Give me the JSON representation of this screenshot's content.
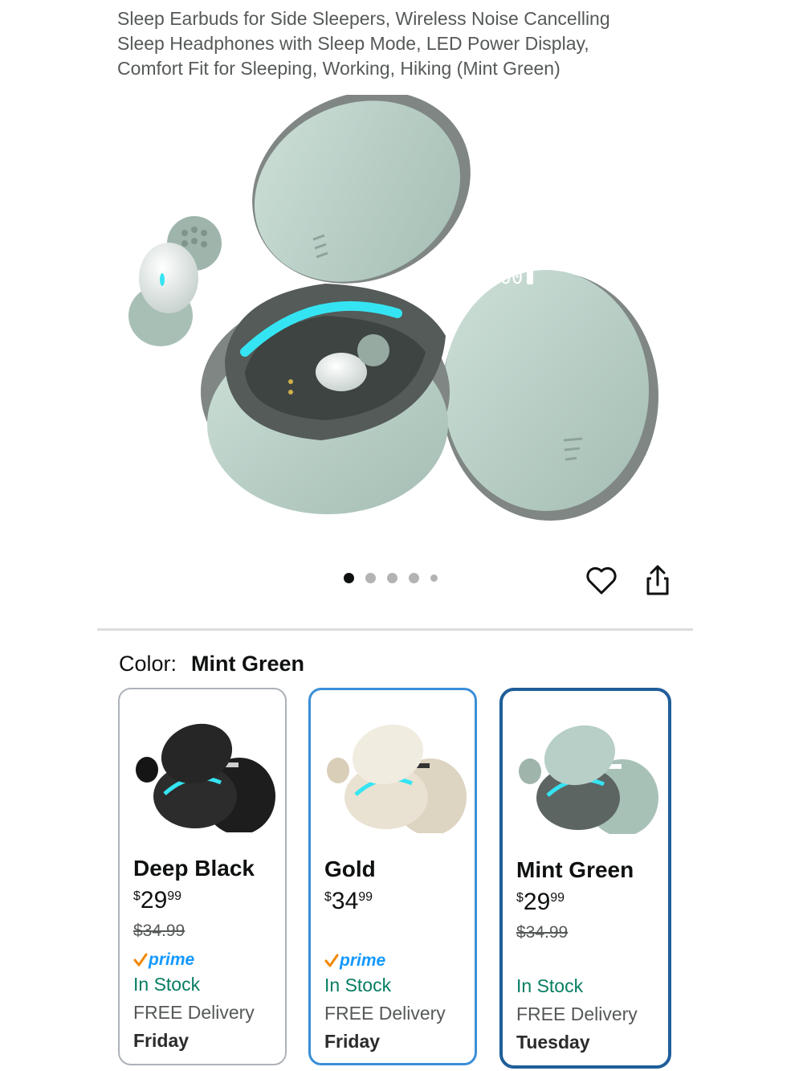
{
  "product": {
    "title_lines": [
      "Sleep Earbuds for Side Sleepers, Wireless Noise Cancelling",
      "Sleep Headphones with Sleep Mode, LED Power Display,",
      "Comfort Fit for Sleeping, Working, Hiking (Mint Green)"
    ],
    "case_display": "100"
  },
  "gallery": {
    "image_count": 5,
    "active_index": 0
  },
  "actions": {
    "wishlist_icon": "heart-icon",
    "share_icon": "share-icon"
  },
  "color_selector": {
    "label": "Color:",
    "selected": "Mint Green",
    "options": [
      {
        "name": "Deep Black",
        "currency": "$",
        "price_whole": "29",
        "price_fraction": "99",
        "list_price": "$34.99",
        "prime": "prime",
        "stock": "In Stock",
        "delivery": "FREE Delivery",
        "day": "Friday",
        "swatch_color": "#2a2a2a"
      },
      {
        "name": "Gold",
        "currency": "$",
        "price_whole": "34",
        "price_fraction": "99",
        "list_price": "",
        "prime": "prime",
        "stock": "In Stock",
        "delivery": "FREE Delivery",
        "day": "Friday",
        "swatch_color": "#e6dfcf"
      },
      {
        "name": "Mint Green",
        "currency": "$",
        "price_whole": "29",
        "price_fraction": "99",
        "list_price": "$34.99",
        "prime": "",
        "stock": "In Stock",
        "delivery": "FREE Delivery",
        "day": "Tuesday",
        "swatch_color": "#b7cfc6"
      }
    ]
  },
  "colors": {
    "mint": "#b7cfc6",
    "glow": "#35e4f2",
    "prime_blue": "#1399ff",
    "prime_check": "#f08804",
    "stock_green": "#067d62",
    "selected_border": "#1f5e99"
  }
}
